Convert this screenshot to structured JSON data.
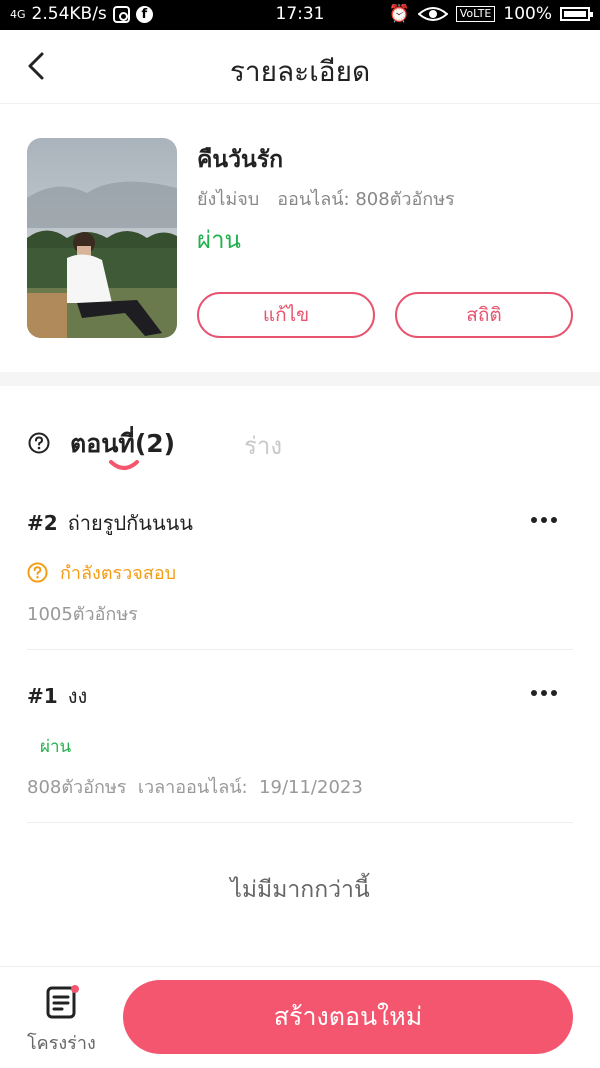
{
  "status_bar": {
    "signal": "4G",
    "speed": "2.54KB/s",
    "time": "17:31",
    "volte": "VoLTE",
    "battery": "100%"
  },
  "header": {
    "title": "รายละเอียด"
  },
  "book": {
    "title": "คืนวันรัก",
    "state": "ยังไม่จบ",
    "online_chars": "ออนไลน์: 808ตัวอักษร",
    "status": "ผ่าน",
    "edit_label": "แก้ไข",
    "stats_label": "สถิติ"
  },
  "tabs": {
    "chapters_label": "ตอนที่(2)",
    "drafts_label": "ร่าง"
  },
  "chapters": [
    {
      "number": "#2",
      "title": "ถ่ายรูปกันนนน",
      "status": "กำลังตรวจสอบ",
      "meta": "1005ตัวอักษร"
    },
    {
      "number": "#1",
      "title": "งง",
      "status": "ผ่าน",
      "meta": "808ตัวอักษร  เวลาออนไลน์:  19/11/2023"
    }
  ],
  "end_text": "ไม่มีมากกว่านี้",
  "bottom": {
    "draft_label": "โครงร่าง",
    "create_label": "สร้างตอนใหม่"
  },
  "colors": {
    "accent": "#f4566f",
    "outline": "#e8546f",
    "passed": "#22b14c",
    "reviewing": "#f39c12"
  }
}
